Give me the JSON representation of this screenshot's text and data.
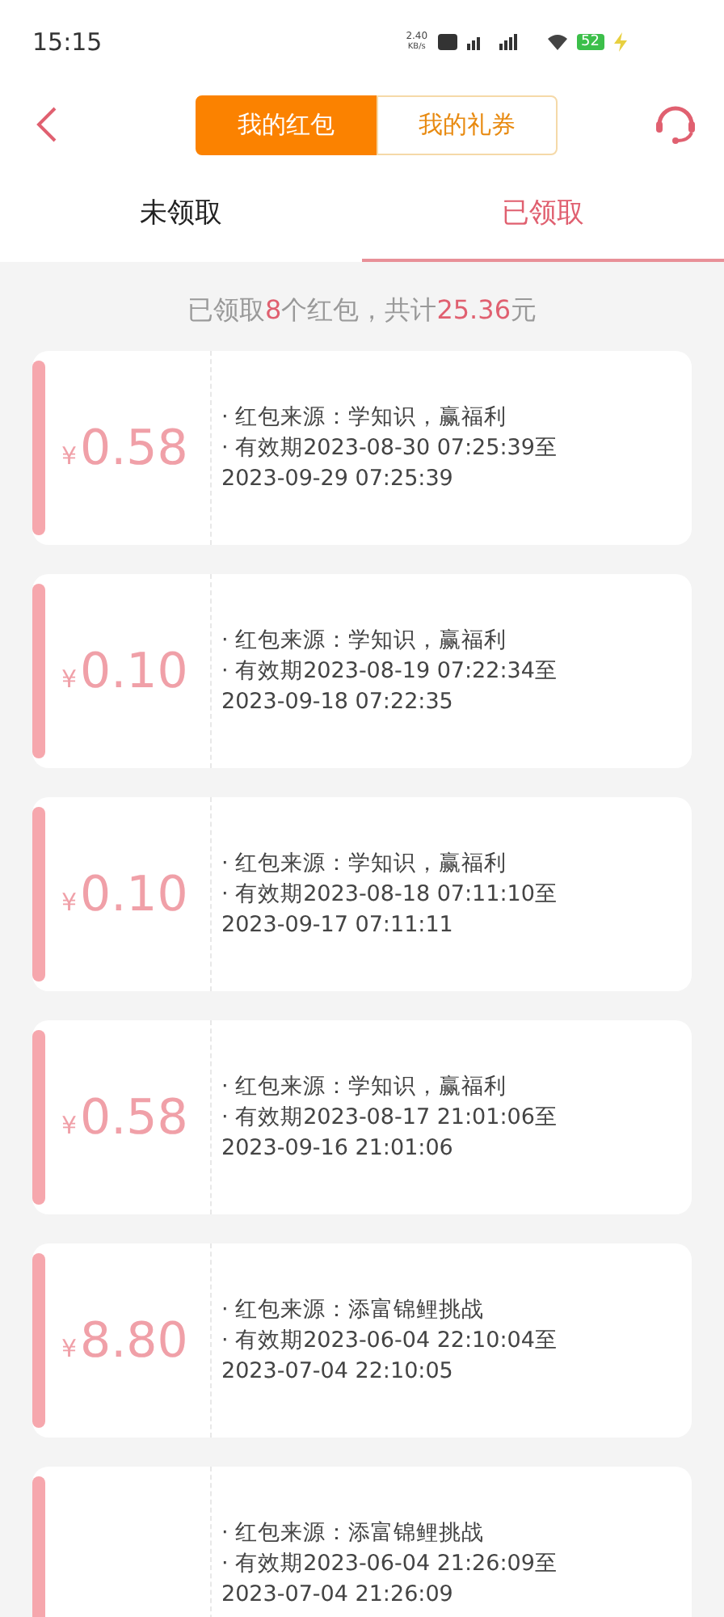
{
  "status_bar": {
    "time": "15:15",
    "speed": "2.40",
    "speed_unit": "KB/s",
    "battery": "52"
  },
  "header": {
    "segments": [
      {
        "label": "我的红包",
        "selected": true
      },
      {
        "label": "我的礼券",
        "selected": false
      }
    ]
  },
  "tabs": [
    {
      "label": "未领取",
      "selected": false
    },
    {
      "label": "已领取",
      "selected": true
    }
  ],
  "summary": "已领取**8**个红包，共计**25.36**元",
  "packets": [
    {
      "currency": "¥",
      "amount": "0.58",
      "source": "· 红包来源：学知识，赢福利",
      "validity": "· 有效期2023-08-30 07:25:39至",
      "end": "2023-09-29 07:25:39"
    },
    {
      "currency": "¥",
      "amount": "0.10",
      "source": "· 红包来源：学知识，赢福利",
      "validity": "· 有效期2023-08-19 07:22:34至",
      "end": "2023-09-18 07:22:35"
    },
    {
      "currency": "¥",
      "amount": "0.10",
      "source": "· 红包来源：学知识，赢福利",
      "validity": "· 有效期2023-08-18 07:11:10至",
      "end": "2023-09-17 07:11:11"
    },
    {
      "currency": "¥",
      "amount": "0.58",
      "source": "· 红包来源：学知识，赢福利",
      "validity": "· 有效期2023-08-17 21:01:06至",
      "end": "2023-09-16 21:01:06"
    },
    {
      "currency": "¥",
      "amount": "8.80",
      "source": "· 红包来源：添富锦鲤挑战",
      "validity": "· 有效期2023-06-04 22:10:04至",
      "end": "2023-07-04 22:10:05"
    },
    {
      "source": "· 红包来源：添富锦鲤挑战",
      "validity": "· 有效期2023-06-04 21:26:09至",
      "end": "2023-07-04 21:26:09"
    }
  ]
}
